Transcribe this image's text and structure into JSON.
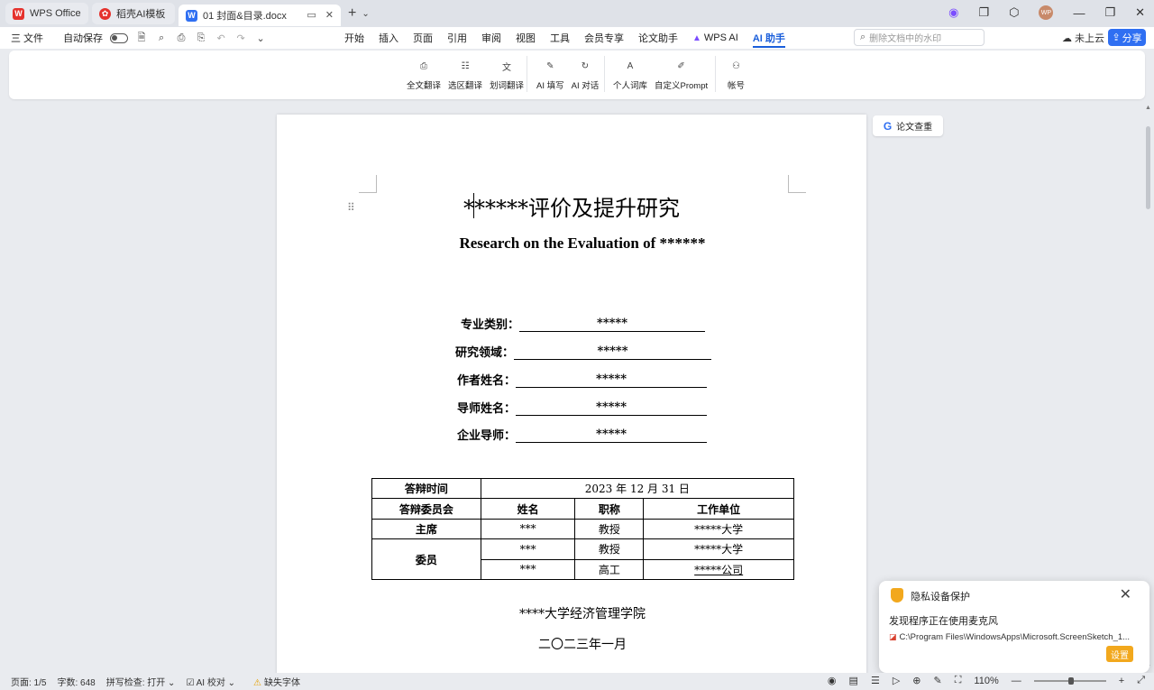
{
  "tabs": {
    "wps": "WPS Office",
    "daoke": "稻壳AI模板",
    "doc": "01 封面&目录.docx"
  },
  "menubar": {
    "file": "三 文件",
    "autosave": "自动保存",
    "menus": [
      "开始",
      "插入",
      "页面",
      "引用",
      "审阅",
      "视图",
      "工具",
      "会员专享",
      "论文助手"
    ],
    "wps_ai": "WPS AI",
    "ai_helper": "AI 助手",
    "search_placeholder": "删除文档中的水印",
    "cloud": "未上云",
    "share": "分享"
  },
  "ribbon": {
    "group1": [
      "全文翻译",
      "选区翻译",
      "划词翻译"
    ],
    "group2": [
      "AI 填写",
      "AI 对话"
    ],
    "group3": [
      "个人词库",
      "自定义Prompt"
    ],
    "group4": [
      "帐号"
    ]
  },
  "document": {
    "title_cn": "******评价及提升研究",
    "title_en": "Research on the Evaluation of ******",
    "fields": [
      {
        "label": "专业类别：",
        "value": "*****"
      },
      {
        "label": "研究领域：",
        "value": "*****"
      },
      {
        "label": "作者姓名：",
        "value": "*****"
      },
      {
        "label": "导师姓名：",
        "value": "*****"
      },
      {
        "label": "企业导师：",
        "value": "*****"
      }
    ],
    "table": {
      "defense_time_label": "答辩时间",
      "defense_time_value": "2023 年 12 月 31 日",
      "committee_label": "答辩委员会",
      "headers": [
        "姓名",
        "职称",
        "工作单位"
      ],
      "chair_label": "主席",
      "member_label": "委员",
      "rows": [
        {
          "name": "***",
          "title": "教授",
          "unit": "*****大学"
        },
        {
          "name": "***",
          "title": "教授",
          "unit": "*****大学"
        },
        {
          "name": "***",
          "title": "高工",
          "unit": "*****公司"
        }
      ]
    },
    "school": "****大学经济管理学院",
    "date": "二〇二三年一月"
  },
  "side": {
    "paper_check": "论文查重"
  },
  "toast": {
    "title": "隐私设备保护",
    "message": "发现程序正在使用麦克风",
    "path": "C:\\Program Files\\WindowsApps\\Microsoft.ScreenSketch_1...",
    "settings": "设置"
  },
  "status": {
    "page": "页面: 1/5",
    "words": "字数: 648",
    "spell": "拼写检查: 打开 ⌄",
    "ai_proof": "AI 校对 ⌄",
    "missing_font": "缺失字体",
    "zoom": "110%"
  }
}
